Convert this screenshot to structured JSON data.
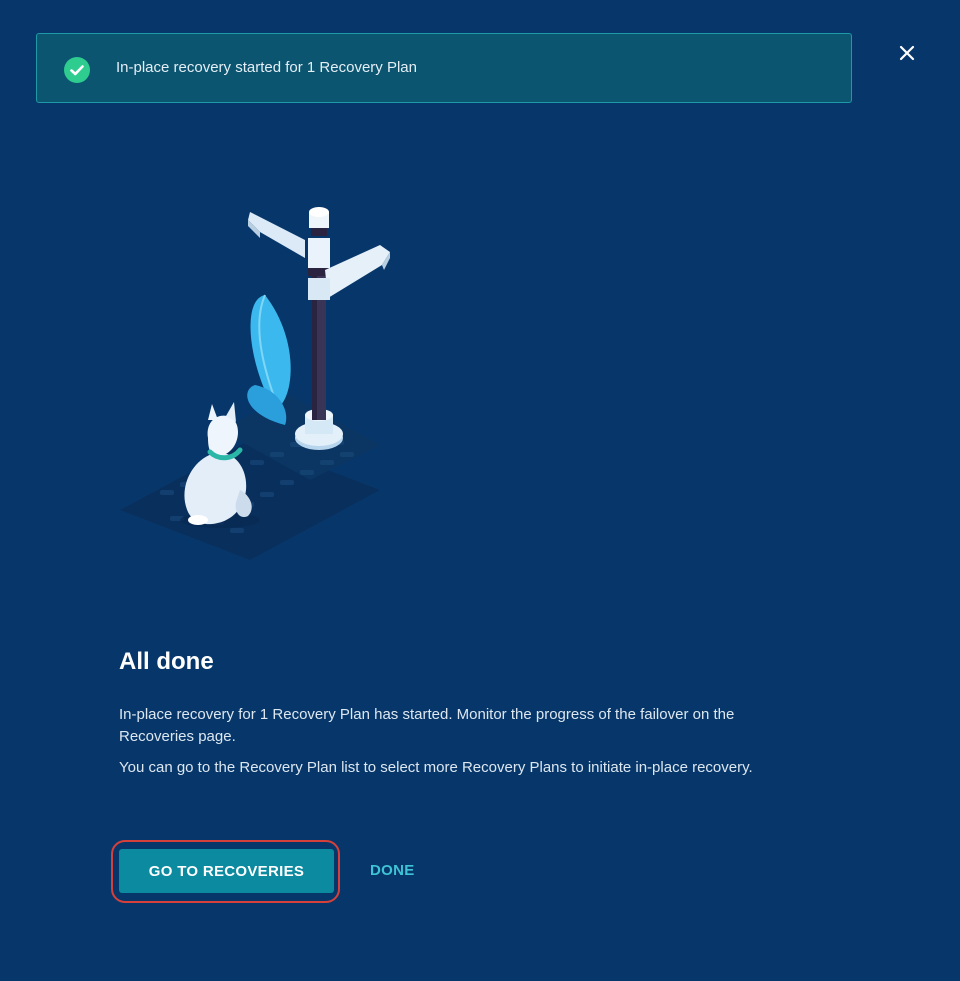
{
  "toast": {
    "message": "In-place recovery started for 1 Recovery Plan",
    "icon": "check-circle-icon",
    "color": "#2ecc8f"
  },
  "dialog": {
    "close_icon": "close-icon",
    "illustration": "signpost-with-dog-illustration",
    "title": "All done",
    "paragraphs": [
      "In-place recovery for 1 Recovery Plan has started. Monitor the progress of the failover on the Recoveries page.",
      "You can go to the Recovery Plan list to select more Recovery Plans to initiate in-place recovery."
    ],
    "primary_button": "GO TO RECOVERIES",
    "secondary_button": "DONE"
  },
  "colors": {
    "background": "#07376a",
    "toast_background": "#0b5570",
    "primary": "#0b8aa0",
    "link": "#3ec4d6",
    "focus_ring": "#d6403a"
  }
}
